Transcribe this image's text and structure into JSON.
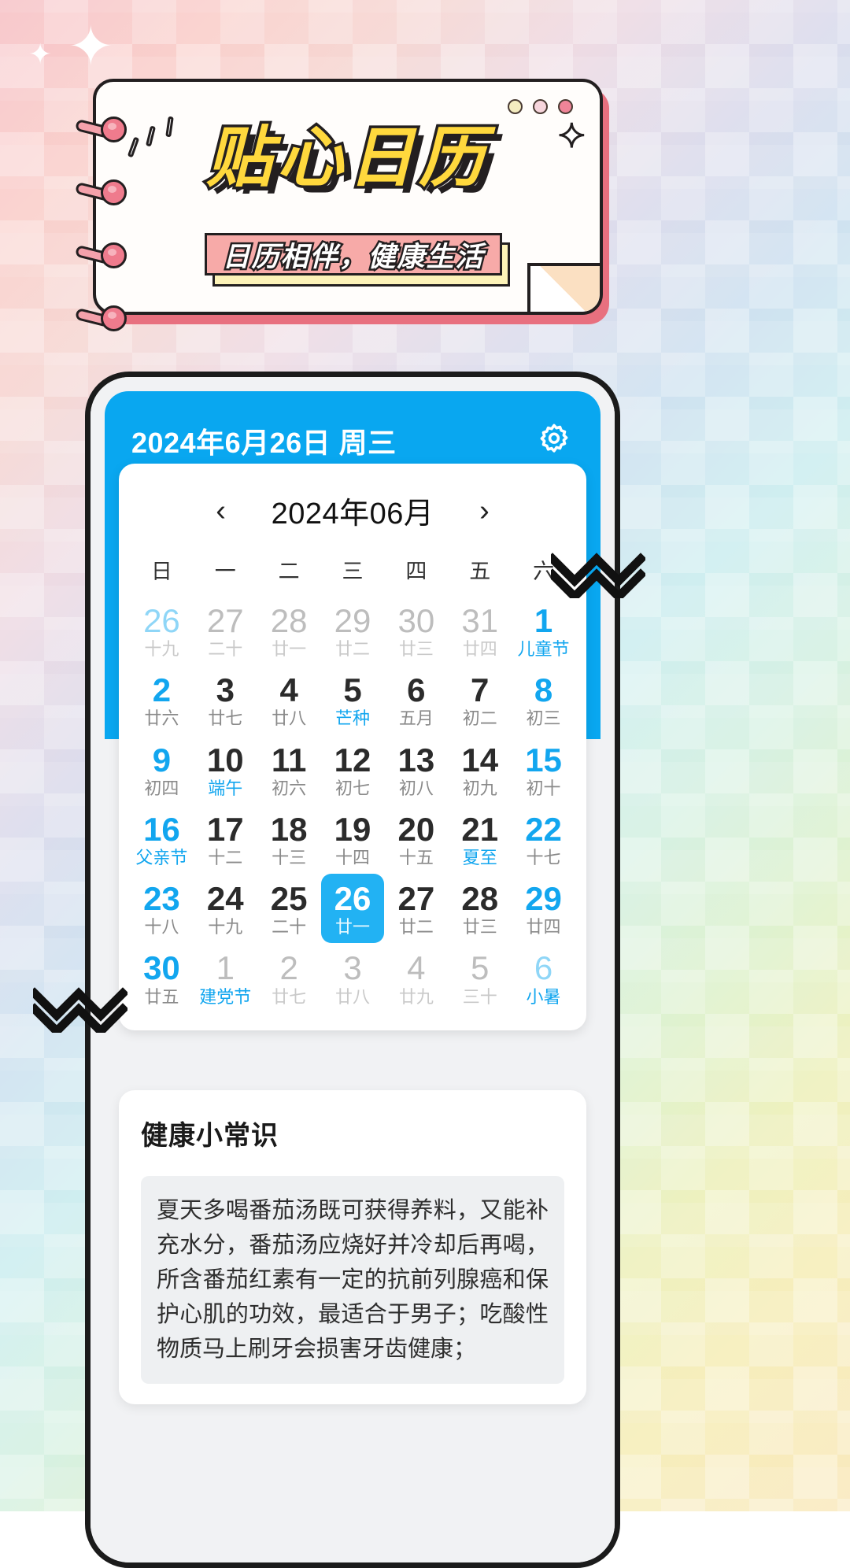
{
  "hero": {
    "title": "贴心日历",
    "subtitle": "日历相伴，健康生活",
    "dots": [
      "#f4ecc0",
      "#f7d5dc",
      "#ef8498"
    ]
  },
  "app": {
    "header": {
      "date_text": "2024年6月26日 周三",
      "settings_icon": "gear-icon",
      "bg_color": "#09a7f0"
    },
    "calendar": {
      "prev_label": "‹",
      "next_label": "›",
      "month_title": "2024年06月",
      "weekdays": [
        "日",
        "一",
        "二",
        "三",
        "四",
        "五",
        "六"
      ],
      "accent_color": "#12a6ef",
      "selected_color": "#22b2f3",
      "days": [
        {
          "num": "26",
          "lunar": "十九",
          "out": true,
          "blue": true,
          "lunarBlue": false,
          "selected": false
        },
        {
          "num": "27",
          "lunar": "二十",
          "out": true,
          "blue": false,
          "lunarBlue": false,
          "selected": false
        },
        {
          "num": "28",
          "lunar": "廿一",
          "out": true,
          "blue": false,
          "lunarBlue": false,
          "selected": false
        },
        {
          "num": "29",
          "lunar": "廿二",
          "out": true,
          "blue": false,
          "lunarBlue": false,
          "selected": false
        },
        {
          "num": "30",
          "lunar": "廿三",
          "out": true,
          "blue": false,
          "lunarBlue": false,
          "selected": false
        },
        {
          "num": "31",
          "lunar": "廿四",
          "out": true,
          "blue": false,
          "lunarBlue": false,
          "selected": false
        },
        {
          "num": "1",
          "lunar": "儿童节",
          "out": false,
          "blue": true,
          "lunarBlue": true,
          "selected": false
        },
        {
          "num": "2",
          "lunar": "廿六",
          "out": false,
          "blue": true,
          "lunarBlue": false,
          "selected": false
        },
        {
          "num": "3",
          "lunar": "廿七",
          "out": false,
          "blue": false,
          "lunarBlue": false,
          "selected": false
        },
        {
          "num": "4",
          "lunar": "廿八",
          "out": false,
          "blue": false,
          "lunarBlue": false,
          "selected": false
        },
        {
          "num": "5",
          "lunar": "芒种",
          "out": false,
          "blue": false,
          "lunarBlue": true,
          "selected": false
        },
        {
          "num": "6",
          "lunar": "五月",
          "out": false,
          "blue": false,
          "lunarBlue": false,
          "selected": false
        },
        {
          "num": "7",
          "lunar": "初二",
          "out": false,
          "blue": false,
          "lunarBlue": false,
          "selected": false
        },
        {
          "num": "8",
          "lunar": "初三",
          "out": false,
          "blue": true,
          "lunarBlue": false,
          "selected": false
        },
        {
          "num": "9",
          "lunar": "初四",
          "out": false,
          "blue": true,
          "lunarBlue": false,
          "selected": false
        },
        {
          "num": "10",
          "lunar": "端午",
          "out": false,
          "blue": false,
          "lunarBlue": true,
          "selected": false
        },
        {
          "num": "11",
          "lunar": "初六",
          "out": false,
          "blue": false,
          "lunarBlue": false,
          "selected": false
        },
        {
          "num": "12",
          "lunar": "初七",
          "out": false,
          "blue": false,
          "lunarBlue": false,
          "selected": false
        },
        {
          "num": "13",
          "lunar": "初八",
          "out": false,
          "blue": false,
          "lunarBlue": false,
          "selected": false
        },
        {
          "num": "14",
          "lunar": "初九",
          "out": false,
          "blue": false,
          "lunarBlue": false,
          "selected": false
        },
        {
          "num": "15",
          "lunar": "初十",
          "out": false,
          "blue": true,
          "lunarBlue": false,
          "selected": false
        },
        {
          "num": "16",
          "lunar": "父亲节",
          "out": false,
          "blue": true,
          "lunarBlue": true,
          "selected": false
        },
        {
          "num": "17",
          "lunar": "十二",
          "out": false,
          "blue": false,
          "lunarBlue": false,
          "selected": false
        },
        {
          "num": "18",
          "lunar": "十三",
          "out": false,
          "blue": false,
          "lunarBlue": false,
          "selected": false
        },
        {
          "num": "19",
          "lunar": "十四",
          "out": false,
          "blue": false,
          "lunarBlue": false,
          "selected": false
        },
        {
          "num": "20",
          "lunar": "十五",
          "out": false,
          "blue": false,
          "lunarBlue": false,
          "selected": false
        },
        {
          "num": "21",
          "lunar": "夏至",
          "out": false,
          "blue": false,
          "lunarBlue": true,
          "selected": false
        },
        {
          "num": "22",
          "lunar": "十七",
          "out": false,
          "blue": true,
          "lunarBlue": false,
          "selected": false
        },
        {
          "num": "23",
          "lunar": "十八",
          "out": false,
          "blue": true,
          "lunarBlue": false,
          "selected": false
        },
        {
          "num": "24",
          "lunar": "十九",
          "out": false,
          "blue": false,
          "lunarBlue": false,
          "selected": false
        },
        {
          "num": "25",
          "lunar": "二十",
          "out": false,
          "blue": false,
          "lunarBlue": false,
          "selected": false
        },
        {
          "num": "26",
          "lunar": "廿一",
          "out": false,
          "blue": false,
          "lunarBlue": false,
          "selected": true
        },
        {
          "num": "27",
          "lunar": "廿二",
          "out": false,
          "blue": false,
          "lunarBlue": false,
          "selected": false
        },
        {
          "num": "28",
          "lunar": "廿三",
          "out": false,
          "blue": false,
          "lunarBlue": false,
          "selected": false
        },
        {
          "num": "29",
          "lunar": "廿四",
          "out": false,
          "blue": true,
          "lunarBlue": false,
          "selected": false
        },
        {
          "num": "30",
          "lunar": "廿五",
          "out": false,
          "blue": true,
          "lunarBlue": false,
          "selected": false
        },
        {
          "num": "1",
          "lunar": "建党节",
          "out": true,
          "blue": false,
          "lunarBlue": true,
          "selected": false
        },
        {
          "num": "2",
          "lunar": "廿七",
          "out": true,
          "blue": false,
          "lunarBlue": false,
          "selected": false
        },
        {
          "num": "3",
          "lunar": "廿八",
          "out": true,
          "blue": false,
          "lunarBlue": false,
          "selected": false
        },
        {
          "num": "4",
          "lunar": "廿九",
          "out": true,
          "blue": false,
          "lunarBlue": false,
          "selected": false
        },
        {
          "num": "5",
          "lunar": "三十",
          "out": true,
          "blue": false,
          "lunarBlue": false,
          "selected": false
        },
        {
          "num": "6",
          "lunar": "小暑",
          "out": true,
          "blue": true,
          "lunarBlue": true,
          "selected": false
        }
      ]
    },
    "tips": {
      "heading": "健康小常识",
      "body": "夏天多喝番茄汤既可获得养料，又能补充水分，番茄汤应烧好并冷却后再喝，所含番茄红素有一定的抗前列腺癌和保护心肌的功效，最适合于男子；吃酸性物质马上刷牙会损害牙齿健康；"
    }
  }
}
